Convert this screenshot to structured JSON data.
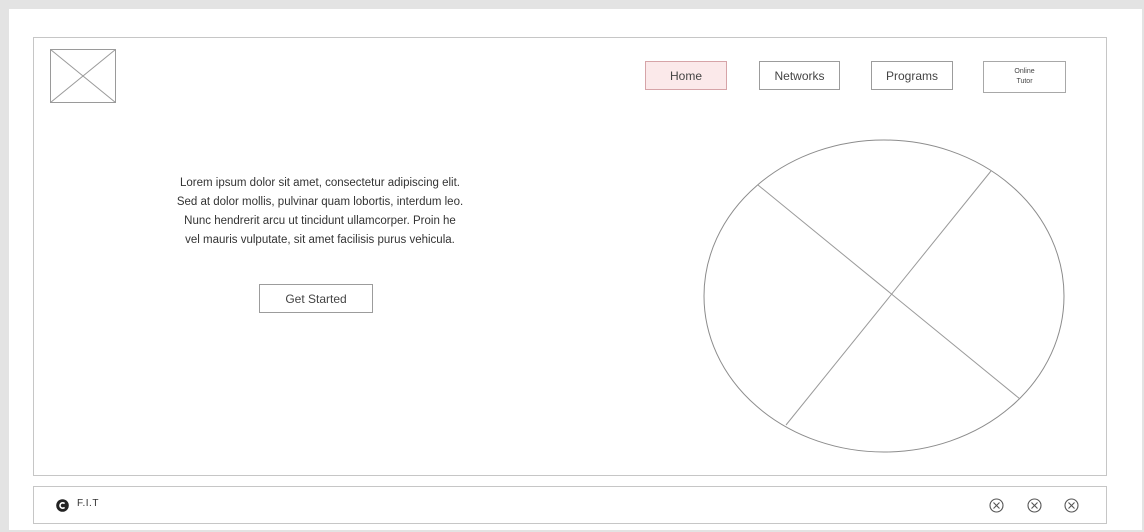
{
  "header": {
    "logo_icon": "image-placeholder-icon",
    "nav": {
      "home": "Home",
      "networks": "Networks",
      "programs": "Programs",
      "online_tutor_line1": "Online",
      "online_tutor_line2": "Tutor"
    },
    "active_tab_color": "#fbe9ea"
  },
  "hero": {
    "intro_line1": "Lorem ipsum dolor sit amet, consectetur adipiscing elit.",
    "intro_line2": "Sed at dolor mollis, pulvinar quam lobortis, interdum leo.",
    "intro_line3": "Nunc hendrerit arcu ut tincidunt ullamcorper. Proin he",
    "intro_line4": "vel mauris vulputate, sit amet facilisis purus vehicula.",
    "cta_label": "Get Started",
    "image_icon": "image-placeholder-icon"
  },
  "footer": {
    "copyright_icon": "copyright-icon",
    "brand": "F.I.T",
    "social_icons": [
      "circle-x-icon",
      "circle-x-icon",
      "circle-x-icon"
    ]
  }
}
